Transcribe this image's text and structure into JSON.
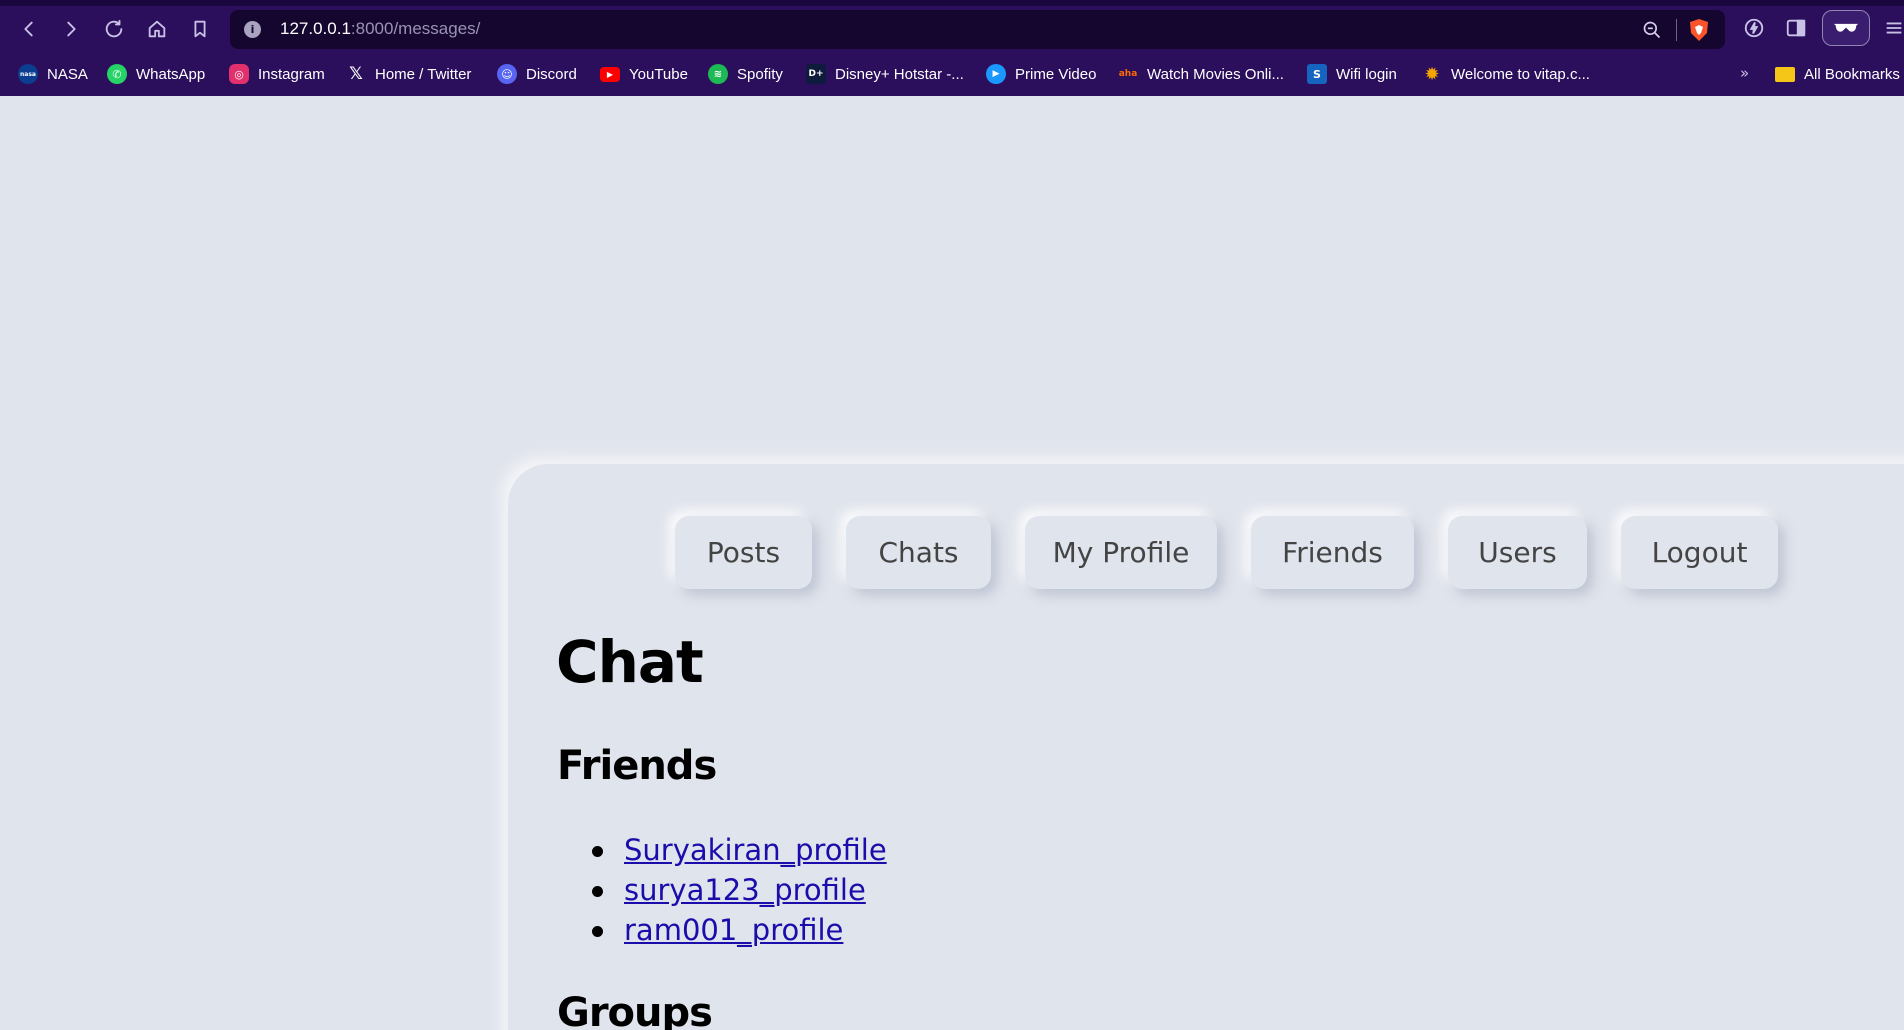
{
  "browser": {
    "url_host": "127.0.0.1",
    "url_rest": ":8000/messages/",
    "bookmarks": [
      {
        "label": "NASA",
        "icon": "nasa-icon",
        "color": "#0b3d91"
      },
      {
        "label": "WhatsApp",
        "icon": "whatsapp-icon",
        "color": "#25d366"
      },
      {
        "label": "Instagram",
        "icon": "instagram-icon",
        "color": "#e1306c"
      },
      {
        "label": "Home / Twitter",
        "icon": "x-icon",
        "color": "#000000"
      },
      {
        "label": "Discord",
        "icon": "discord-icon",
        "color": "#5865f2"
      },
      {
        "label": "YouTube",
        "icon": "youtube-icon",
        "color": "#ff0000"
      },
      {
        "label": "Spofity",
        "icon": "spotify-icon",
        "color": "#1db954"
      },
      {
        "label": "Disney+ Hotstar -...",
        "icon": "hotstar-icon",
        "color": "#0f1b3d"
      },
      {
        "label": "Prime Video",
        "icon": "prime-video-icon",
        "color": "#1a98ff"
      },
      {
        "label": "Watch Movies Onli...",
        "icon": "aha-icon",
        "color": "#ff6a00"
      },
      {
        "label": "Wifi login",
        "icon": "wifi-login-icon",
        "color": "#1565c0"
      },
      {
        "label": "Welcome to vitap.c...",
        "icon": "vitap-icon",
        "color": "#f4a300"
      }
    ],
    "more_label": "»",
    "all_bookmarks_label": "All Bookmarks"
  },
  "nav": {
    "items": [
      "Posts",
      "Chats",
      "My Profile",
      "Friends",
      "Users",
      "Logout"
    ]
  },
  "page": {
    "title": "Chat",
    "friends_heading": "Friends",
    "friends": [
      "Suryakiran_profile",
      "surya123_profile",
      "ram001_profile"
    ],
    "groups_heading": "Groups"
  },
  "colors": {
    "page_bg": "#e0e4ec",
    "chrome_bg": "#2b0f5c",
    "link": "#1a0dab"
  }
}
